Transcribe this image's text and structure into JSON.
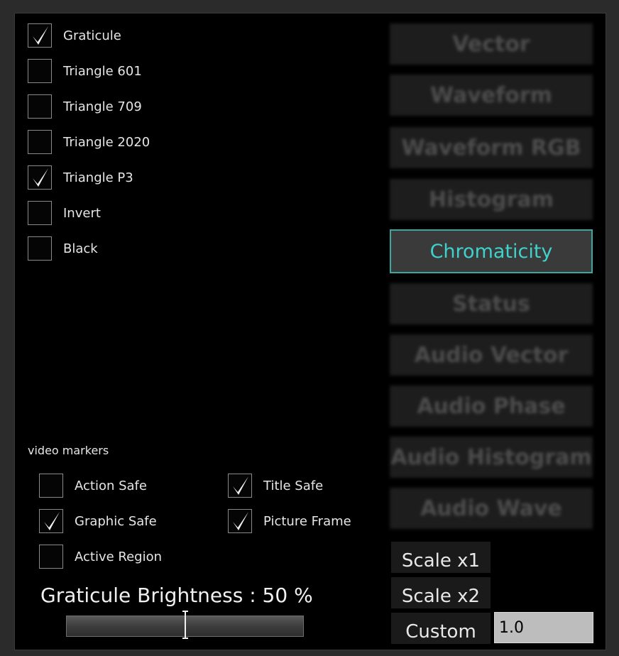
{
  "graticule_options": [
    {
      "label": "Graticule",
      "checked": true
    },
    {
      "label": "Triangle 601",
      "checked": false
    },
    {
      "label": "Triangle 709",
      "checked": false
    },
    {
      "label": "Triangle 2020",
      "checked": false
    },
    {
      "label": "Triangle P3",
      "checked": true
    },
    {
      "label": "Invert",
      "checked": false
    },
    {
      "label": "Black",
      "checked": false
    }
  ],
  "video_markers": {
    "heading": "video markers",
    "items": [
      {
        "label": "Action Safe",
        "checked": false
      },
      {
        "label": "Title Safe",
        "checked": true
      },
      {
        "label": "Graphic Safe",
        "checked": true
      },
      {
        "label": "Picture Frame",
        "checked": true
      },
      {
        "label": "Active Region",
        "checked": false
      }
    ]
  },
  "scopes": {
    "items": [
      "Vector",
      "Waveform",
      "Waveform RGB",
      "Histogram",
      "Chromaticity",
      "Status",
      "Audio Vector",
      "Audio Phase",
      "Audio Histogram",
      "Audio Wave"
    ],
    "active": "Chromaticity",
    "active_color": "#3fd2cc"
  },
  "scale": {
    "x1": "Scale x1",
    "x2": "Scale x2",
    "custom": "Custom",
    "custom_value": "1.0"
  },
  "brightness": {
    "label": "Graticule Brightness : 50 %",
    "value_fraction": 0.5
  }
}
